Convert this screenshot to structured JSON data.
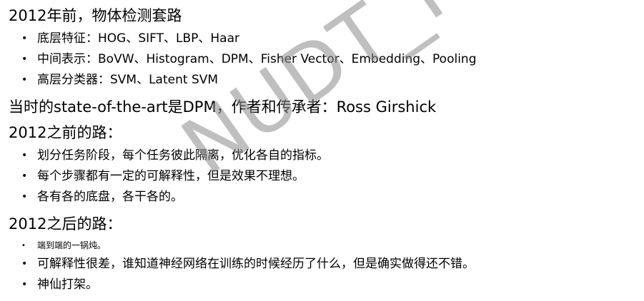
{
  "section1": {
    "heading": "2012年前，物体检测套路",
    "bullets": [
      "底层特征：HOG、SIFT、LBP、Haar",
      "中间表示：BoVW、Histogram、DPM、Fisher Vector、Embedding、Pooling",
      "高层分类器：SVM、Latent SVM"
    ]
  },
  "statement": "当时的state-of-the-art是DPM，作者和传承者：Ross Girshick",
  "section2": {
    "heading": "2012之前的路：",
    "bullets": [
      "划分任务阶段，每个任务彼此隔离，优化各自的指标。",
      "每个步骤都有一定的可解释性，但是效果不理想。",
      "各有各的底盘，各干各的。"
    ]
  },
  "section3": {
    "heading": "2012之后的路：",
    "bullets": [
      "端到端的一锅炖。",
      "可解释性很差，谁知道神经网络在训练的时候经历了什么，但是确实做得还不错。",
      "神仙打架。"
    ]
  },
  "watermark": "NUDT_PDL",
  "bullet_symbol": "•"
}
